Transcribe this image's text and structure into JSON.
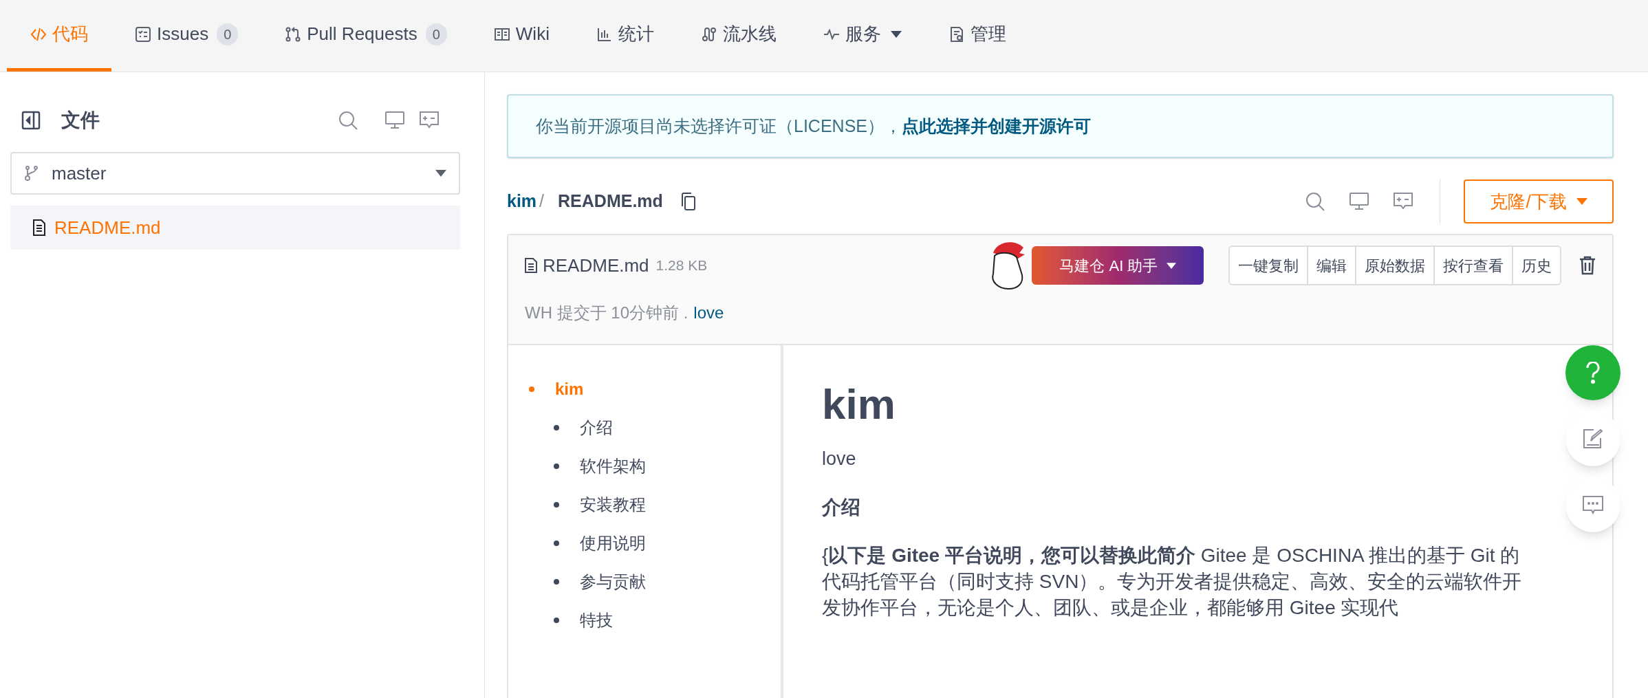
{
  "tabs": [
    {
      "label": "代码",
      "kind": "code",
      "selected": true
    },
    {
      "label": "Issues",
      "kind": "issues",
      "count": "0",
      "selected": false
    },
    {
      "label": "Pull Requests",
      "kind": "pr",
      "count": "0",
      "selected": false
    },
    {
      "label": "Wiki",
      "kind": "wiki",
      "selected": false
    },
    {
      "label": "统计",
      "kind": "stats",
      "selected": false
    },
    {
      "label": "流水线",
      "kind": "pipeline",
      "selected": false
    },
    {
      "label": "服务",
      "kind": "pulse",
      "dropdown": true,
      "selected": false
    },
    {
      "label": "管理",
      "kind": "manage",
      "selected": false
    }
  ],
  "sidebar": {
    "title": "文件",
    "branch": "master",
    "files": [
      {
        "name": "README.md",
        "selected": true
      }
    ]
  },
  "license_notice": {
    "text": "你当前开源项目尚未选择许可证（LICENSE），",
    "link": "点此选择并创建开源许可"
  },
  "breadcrumb": {
    "repo": "kim",
    "separator": "/",
    "file": "README.md"
  },
  "clone_button": "克隆/下载",
  "file": {
    "name": "README.md",
    "size": "1.28 KB",
    "ai_button": "马建仓 AI 助手",
    "actions": [
      "一键复制",
      "编辑",
      "原始数据",
      "按行查看",
      "历史"
    ],
    "commit_info": "WH 提交于 10分钟前 .",
    "commit_message": "love"
  },
  "toc": [
    {
      "label": "kim",
      "selected": true,
      "children": [
        {
          "label": "介绍"
        },
        {
          "label": "软件架构"
        },
        {
          "label": "安装教程"
        },
        {
          "label": "使用说明"
        },
        {
          "label": "参与贡献"
        },
        {
          "label": "特技"
        }
      ]
    }
  ],
  "readme": {
    "title": "kim",
    "subtitle": "love",
    "section": "介绍",
    "paragraph": "{**以下是 Gitee 平台说明，您可以替换此简介** Gitee 是 OSCHINA 推出的基于 Git 的代码托管平台（同时支持 SVN）。专为开发者提供稳定、高效、安全的云端软件开发协作平台，无论是个人、团队、或是企业，都能够用 Gitee 实现代"
  }
}
